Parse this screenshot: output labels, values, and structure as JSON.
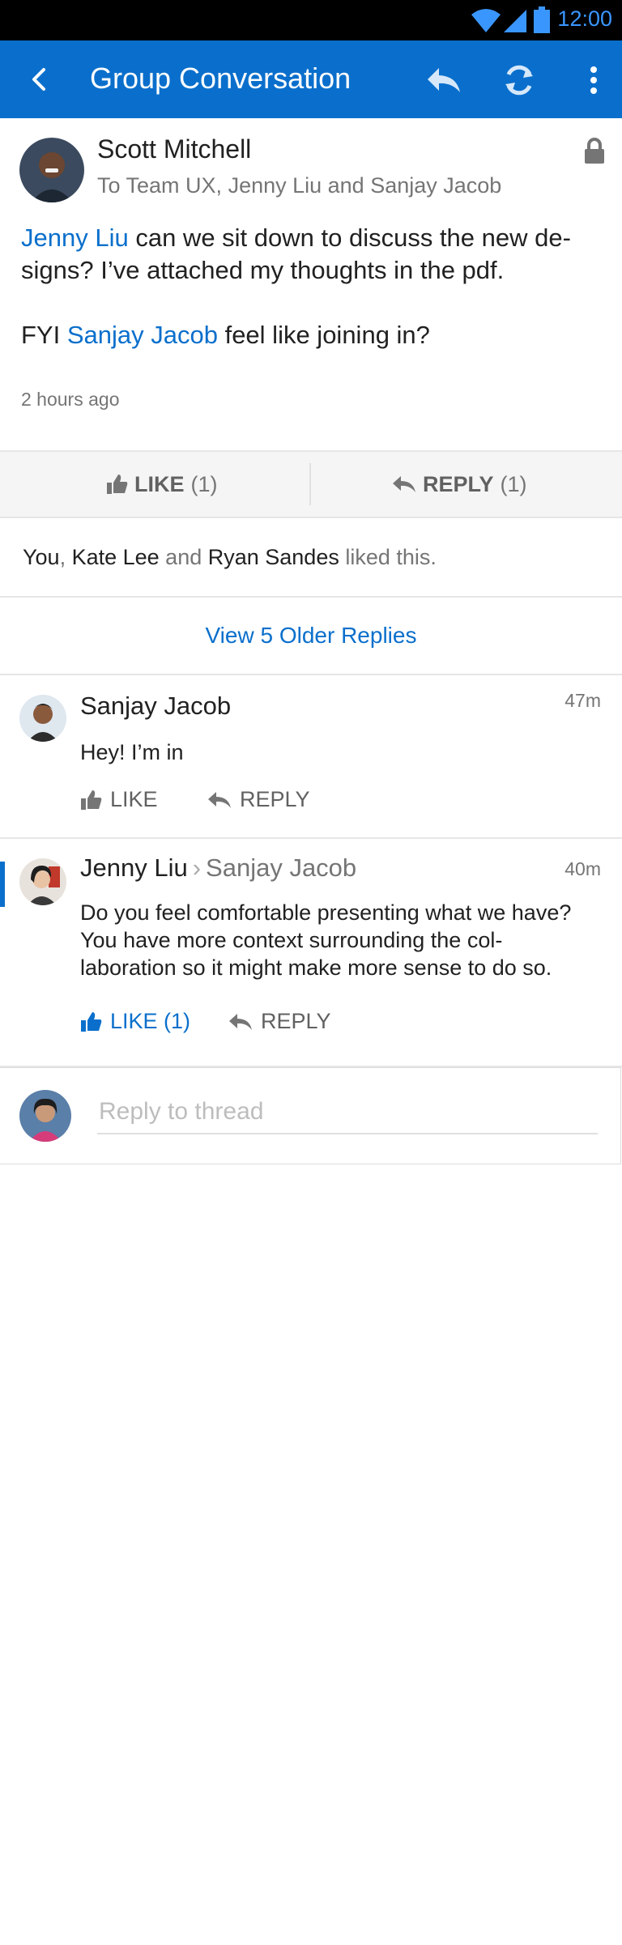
{
  "status_bar": {
    "time": "12:00"
  },
  "app_bar": {
    "title": "Group Conversation"
  },
  "post": {
    "author": "Scott Mitchell",
    "recipients": "To Team UX, Jenny Liu and Sanjay Jacob",
    "body": [
      {
        "mention": "Jenny Liu",
        "text": " can we sit down to discuss the new de-signs? I’ve attached my thoughts in the pdf."
      },
      {
        "prefix": "FYI ",
        "mention": "Sanjay Jacob",
        "text": " feel like joining in?"
      }
    ],
    "timestamp": "2 hours ago"
  },
  "actions": {
    "like_label": "LIKE",
    "like_count": "(1)",
    "reply_label": "REPLY",
    "reply_count": "(1)"
  },
  "likers": {
    "you": "You",
    "sep1": ", ",
    "person1": "Kate Lee",
    "and": " and ",
    "person2": "Ryan Sandes",
    "suffix": " liked this."
  },
  "older_replies": "View 5 Older Replies",
  "replies": [
    {
      "author": "Sanjay Jacob",
      "age": "47m",
      "text": "Hey! I’m in",
      "like": "LIKE",
      "reply": "REPLY"
    },
    {
      "author": "Jenny Liu",
      "to": "Sanjay Jacob",
      "age": "40m",
      "text": "Do you feel comfortable presenting what we have? You have more context surrounding the col-laboration so it might make more sense to do so.",
      "like": "LIKE (1)",
      "reply": "REPLY"
    }
  ],
  "composer": {
    "placeholder": "Reply to thread"
  },
  "colors": {
    "accent": "#0a6fcc",
    "status_bar": "#000000",
    "muted": "#757575"
  }
}
